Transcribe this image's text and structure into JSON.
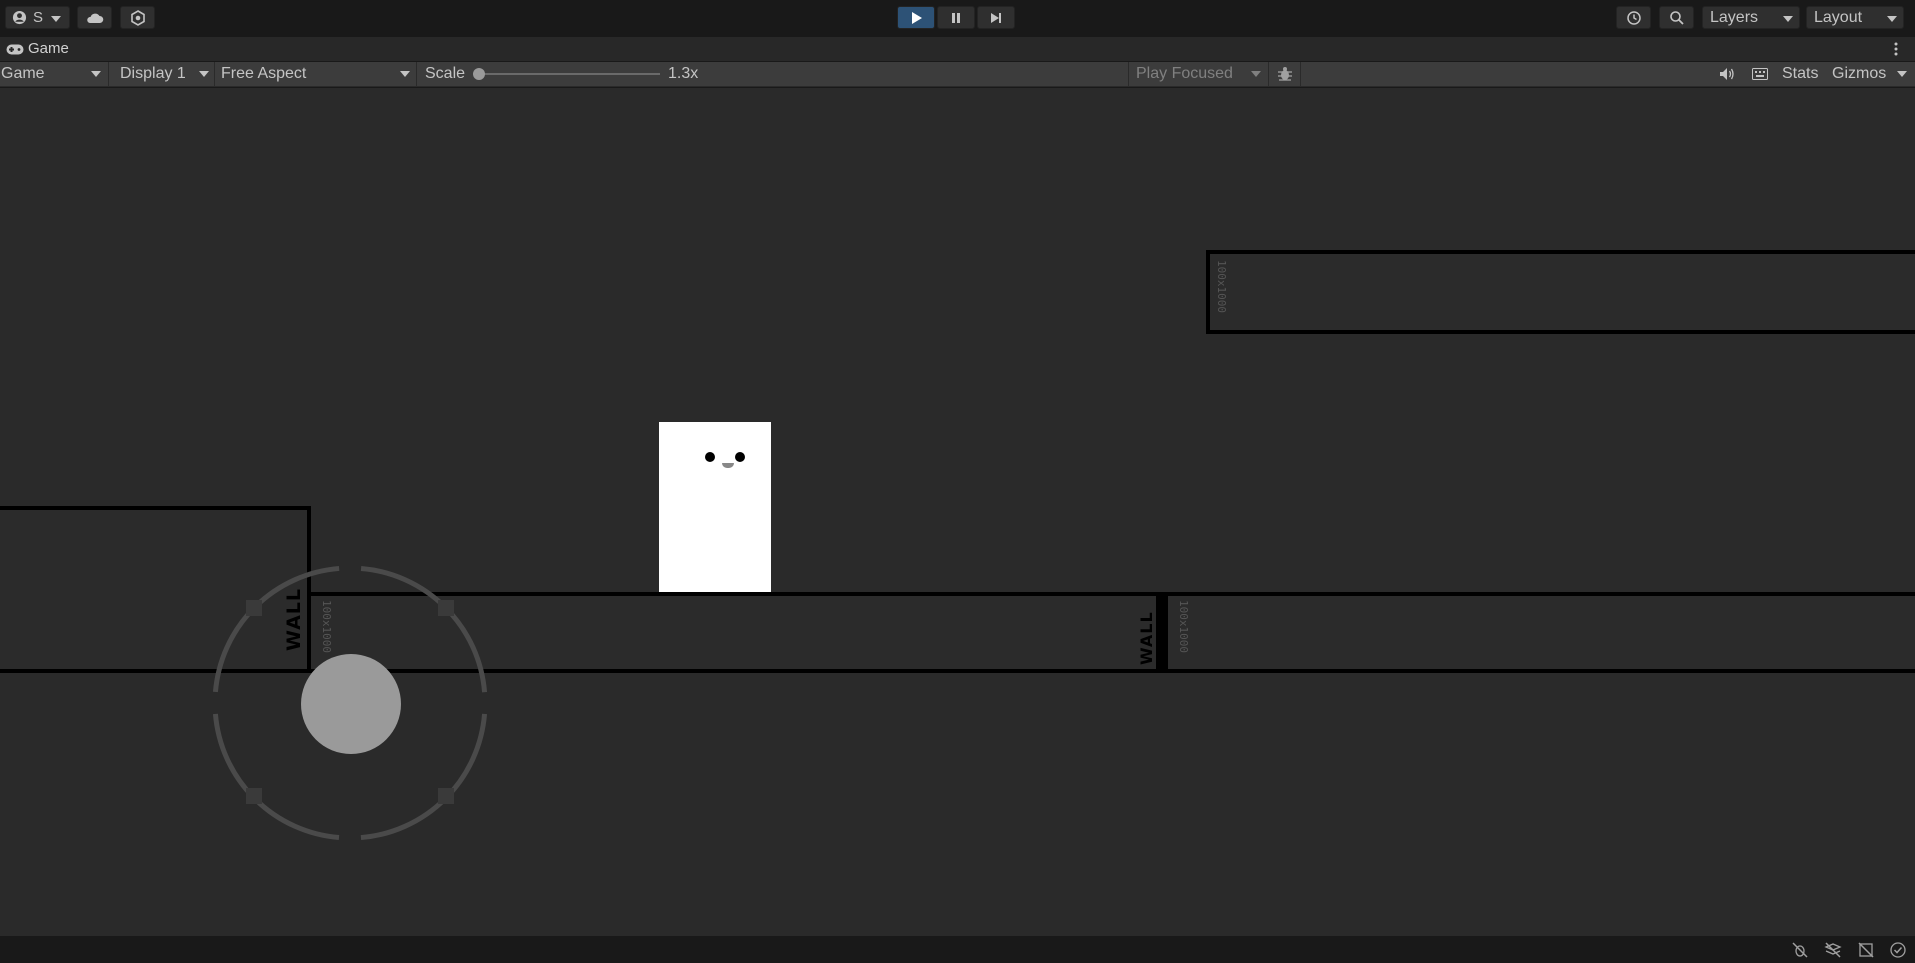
{
  "toolbar": {
    "account_label": "S",
    "layers_label": "Layers",
    "layout_label": "Layout"
  },
  "tab": {
    "title": "Game"
  },
  "game_bar": {
    "mode": "Game",
    "display": "Display 1",
    "aspect": "Free Aspect",
    "scale_label": "Scale",
    "scale_value": "1.3x",
    "play_focused": "Play Focused",
    "stats": "Stats",
    "gizmos": "Gizmos"
  },
  "scene": {
    "wall_text_1": "WALL",
    "wall_text_2": "WALL",
    "ground_tag_1": "100x1000",
    "ground_tag_2": "100x1000",
    "top_platform_tag": "100x1000"
  },
  "colors": {
    "play_active": "#2d5276",
    "viewport_bg": "#2a2a2a",
    "platform_border": "#000000",
    "player": "#ffffff"
  }
}
